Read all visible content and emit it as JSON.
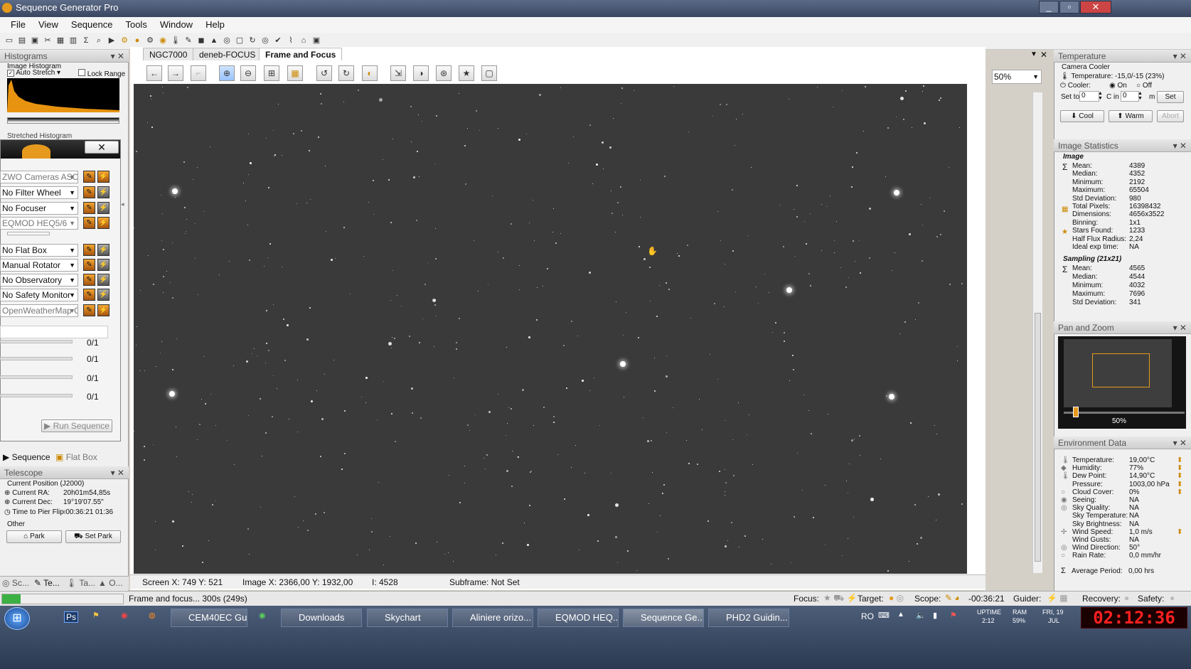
{
  "app": {
    "title": "Sequence Generator Pro",
    "menu": [
      "File",
      "View",
      "Sequence",
      "Tools",
      "Window",
      "Help"
    ]
  },
  "tabs": [
    "NGC7000",
    "deneb-FOCUS",
    "Frame and Focus"
  ],
  "zoom": "50%",
  "histograms": {
    "title": "Histograms",
    "image_histogram": "Image Histogram",
    "auto_stretch": "Auto Stretch",
    "lock_range": "Lock Range",
    "stretched": "Stretched Histogram"
  },
  "equipment": [
    {
      "label": "ZWO Cameras ASCOM",
      "color": "orange"
    },
    {
      "label": "No Filter Wheel",
      "color": "orange"
    },
    {
      "label": "No Focuser",
      "color": "orange"
    },
    {
      "label": "EQMOD HEQ5/6",
      "color": "orange"
    },
    {
      "label": "No Flat Box",
      "color": "orange"
    },
    {
      "label": "Manual Rotator",
      "color": "orange"
    },
    {
      "label": "No Observatory",
      "color": "orange"
    },
    {
      "label": "No Safety Monitor",
      "color": "orange"
    },
    {
      "label": "OpenWeatherMap C",
      "color": "orange"
    }
  ],
  "sequence_rows": [
    "0/1",
    "0/1",
    "0/1",
    "0/1"
  ],
  "run_sequence": "Run Sequence",
  "left_tabs": {
    "sequence": "Sequence",
    "flat_box": "Flat Box"
  },
  "telescope": {
    "title": "Telescope",
    "current_position": "Current Position (J2000)",
    "ra_label": "Current RA:",
    "ra": "20h01m54,85s",
    "dec_label": "Current Dec:",
    "dec": "19°19'07.55\"",
    "pier_label": "Time to Pier Flip:",
    "pier": "-00:36:21  01:36",
    "other": "Other",
    "park": "Park",
    "set_park": "Set Park"
  },
  "bottom_left_tabs": [
    "Sc...",
    "Te...",
    "Ta...",
    "O..."
  ],
  "temperature": {
    "title": "Temperature",
    "camera_cooler": "Camera Cooler",
    "temp": "Temperature: -15,0/-15 (23%)",
    "cooler": "Cooler:",
    "on": "On",
    "off": "Off",
    "set_to": "Set to",
    "set_val": "0",
    "c_in": "C in",
    "c_in_val": "0",
    "m": "m",
    "set": "Set",
    "cool": "Cool",
    "warm": "Warm",
    "abort": "Abort"
  },
  "image_statistics": {
    "title": "Image Statistics",
    "image_head": "Image",
    "rows": [
      [
        "Mean:",
        "4389"
      ],
      [
        "Median:",
        "4352"
      ],
      [
        "Minimum:",
        "2192"
      ],
      [
        "Maximum:",
        "65504"
      ],
      [
        "Std Deviation:",
        "980"
      ],
      [
        "Total Pixels:",
        "16398432"
      ],
      [
        "Dimensions:",
        "4656x3522"
      ],
      [
        "Binning:",
        "1x1"
      ],
      [
        "Stars Found:",
        "1233"
      ],
      [
        "Half Flux Radius:",
        "2,24"
      ],
      [
        "Ideal exp time:",
        "NA"
      ]
    ],
    "sampling_head": "Sampling (21x21)",
    "sampling": [
      [
        "Mean:",
        "4565"
      ],
      [
        "Median:",
        "4544"
      ],
      [
        "Minimum:",
        "4032"
      ],
      [
        "Maximum:",
        "7696"
      ],
      [
        "Std Deviation:",
        "341"
      ]
    ]
  },
  "pan_zoom": {
    "title": "Pan and Zoom",
    "zoom": "50%",
    "slider_fraction": 0.08
  },
  "environment": {
    "title": "Environment Data",
    "rows": [
      [
        "Temperature:",
        "19,00°C"
      ],
      [
        "Humidity:",
        "77%"
      ],
      [
        "Dew Point:",
        "14,90°C"
      ],
      [
        "Pressure:",
        "1003,00 hPa"
      ],
      [
        "Cloud Cover:",
        "0%"
      ],
      [
        "Seeing:",
        "NA"
      ],
      [
        "Sky Quality:",
        "NA"
      ],
      [
        "Sky Temperature:",
        "NA"
      ],
      [
        "Sky Brightness:",
        "NA"
      ],
      [
        "Wind Speed:",
        "1,0 m/s"
      ],
      [
        "Wind Gusts:",
        "NA"
      ],
      [
        "Wind Direction:",
        "50°"
      ],
      [
        "Rain Rate:",
        "0,0 mm/hr"
      ]
    ],
    "average": [
      "Average Period:",
      "0,00 hrs"
    ]
  },
  "statusbar": {
    "screen": "Screen X: 749 Y: 521",
    "image": "Image X: 2366,00 Y: 1932,00",
    "intensity": "I: 4528",
    "subframe": "Subframe: Not Set"
  },
  "footer": {
    "status": "Frame and focus... 300s (249s)",
    "focus": "Focus:",
    "target": "Target:",
    "scope": "Scope:",
    "scope_time": "-00:36:21",
    "guider": "Guider:",
    "recovery": "Recovery:",
    "safety": "Safety:"
  },
  "taskbar": {
    "items": [
      "CEM40EC Gui...",
      "Downloads",
      "Skychart",
      "Aliniere orizo...",
      "EQMOD HEQ...",
      "Sequence Ge...",
      "PHD2 Guidin..."
    ],
    "lang": "RO",
    "uptime": "UPTIME",
    "uptime_val": "2:12",
    "ram": "RAM",
    "ram_val": "59%",
    "date": "FRI, 19",
    "month": "JUL",
    "clock": "02:12:36"
  }
}
